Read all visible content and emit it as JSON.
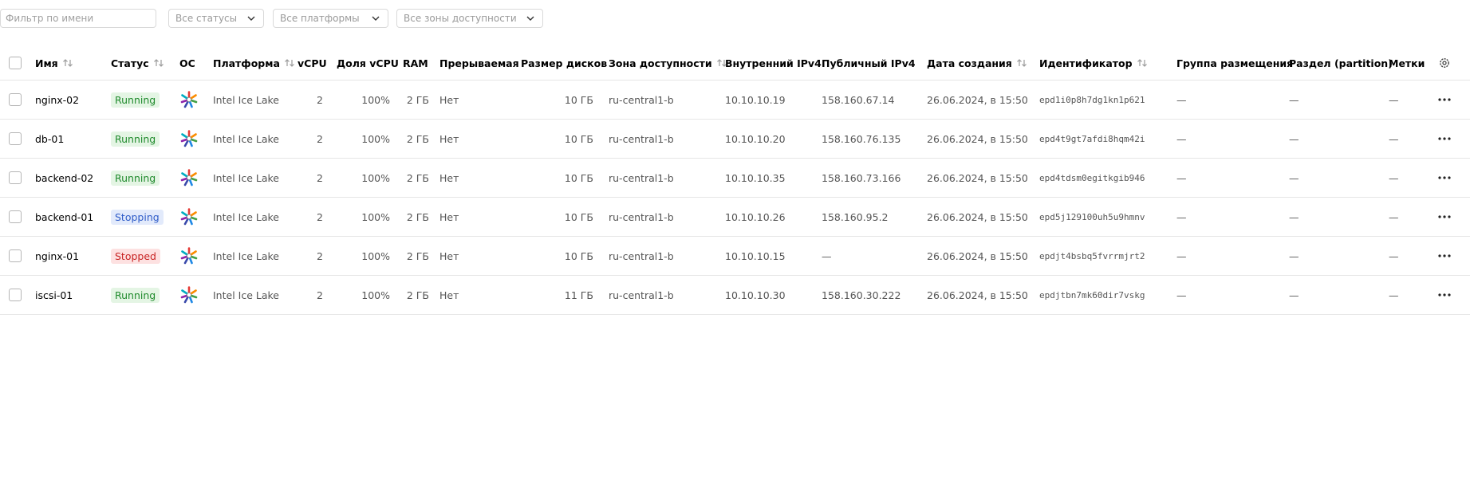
{
  "filters": {
    "name_placeholder": "Фильтр по имени",
    "status_label": "Все статусы",
    "platform_label": "Все платформы",
    "zone_label": "Все зоны доступности"
  },
  "columns": {
    "name": "Имя",
    "status": "Статус",
    "os": "ОС",
    "platform": "Платформа",
    "vcpu": "vCPU",
    "vcpu_share": "Доля vCPU",
    "ram": "RAM",
    "preemptible": "Прерываемая",
    "disk_size": "Размер дисков",
    "zone": "Зона доступности",
    "internal_ip": "Внутренний IPv4",
    "public_ip": "Публичный IPv4",
    "created": "Дата создания",
    "id": "Идентификатор",
    "placement_group": "Группа размещения",
    "partition": "Раздел (partition)",
    "labels": "Метки"
  },
  "icons": {
    "os": "os-distro-icon",
    "sort": "sort-arrows-icon",
    "settings": "gear-icon",
    "actions": "more-dots-icon",
    "dropdown": "chevron-down-icon"
  },
  "status_colors": {
    "running_bg": "#e4f5e4",
    "running_fg": "#1f8a2c",
    "stopping_bg": "#e2eafb",
    "stopping_fg": "#2f5cc8",
    "stopped_bg": "#fde1e1",
    "stopped_fg": "#c82424"
  },
  "rows": [
    {
      "name": "nginx-02",
      "status": "Running",
      "status_kind": "running",
      "platform": "Intel Ice Lake",
      "vcpu": "2",
      "vcpu_share": "100%",
      "ram": "2 ГБ",
      "preemptible": "Нет",
      "disk": "10 ГБ",
      "zone": "ru-central1-b",
      "internal_ip": "10.10.10.19",
      "public_ip": "158.160.67.14",
      "created": "26.06.2024, в 15:50",
      "id": "epd1i0p8h7dg1kn1p621",
      "placement_group": "—",
      "partition": "—",
      "labels": "—"
    },
    {
      "name": "db-01",
      "status": "Running",
      "status_kind": "running",
      "platform": "Intel Ice Lake",
      "vcpu": "2",
      "vcpu_share": "100%",
      "ram": "2 ГБ",
      "preemptible": "Нет",
      "disk": "10 ГБ",
      "zone": "ru-central1-b",
      "internal_ip": "10.10.10.20",
      "public_ip": "158.160.76.135",
      "created": "26.06.2024, в 15:50",
      "id": "epd4t9gt7afdi8hqm42i",
      "placement_group": "—",
      "partition": "—",
      "labels": "—"
    },
    {
      "name": "backend-02",
      "status": "Running",
      "status_kind": "running",
      "platform": "Intel Ice Lake",
      "vcpu": "2",
      "vcpu_share": "100%",
      "ram": "2 ГБ",
      "preemptible": "Нет",
      "disk": "10 ГБ",
      "zone": "ru-central1-b",
      "internal_ip": "10.10.10.35",
      "public_ip": "158.160.73.166",
      "created": "26.06.2024, в 15:50",
      "id": "epd4tdsm0egitkgib946",
      "placement_group": "—",
      "partition": "—",
      "labels": "—"
    },
    {
      "name": "backend-01",
      "status": "Stopping",
      "status_kind": "stopping",
      "platform": "Intel Ice Lake",
      "vcpu": "2",
      "vcpu_share": "100%",
      "ram": "2 ГБ",
      "preemptible": "Нет",
      "disk": "10 ГБ",
      "zone": "ru-central1-b",
      "internal_ip": "10.10.10.26",
      "public_ip": "158.160.95.2",
      "created": "26.06.2024, в 15:50",
      "id": "epd5j129100uh5u9hmnv",
      "placement_group": "—",
      "partition": "—",
      "labels": "—"
    },
    {
      "name": "nginx-01",
      "status": "Stopped",
      "status_kind": "stopped",
      "platform": "Intel Ice Lake",
      "vcpu": "2",
      "vcpu_share": "100%",
      "ram": "2 ГБ",
      "preemptible": "Нет",
      "disk": "10 ГБ",
      "zone": "ru-central1-b",
      "internal_ip": "10.10.10.15",
      "public_ip": "—",
      "created": "26.06.2024, в 15:50",
      "id": "epdjt4bsbq5fvrrmjrt2",
      "placement_group": "—",
      "partition": "—",
      "labels": "—"
    },
    {
      "name": "iscsi-01",
      "status": "Running",
      "status_kind": "running",
      "platform": "Intel Ice Lake",
      "vcpu": "2",
      "vcpu_share": "100%",
      "ram": "2 ГБ",
      "preemptible": "Нет",
      "disk": "11 ГБ",
      "zone": "ru-central1-b",
      "internal_ip": "10.10.10.30",
      "public_ip": "158.160.30.222",
      "created": "26.06.2024, в 15:50",
      "id": "epdjtbn7mk60dir7vskg",
      "placement_group": "—",
      "partition": "—",
      "labels": "—"
    }
  ]
}
